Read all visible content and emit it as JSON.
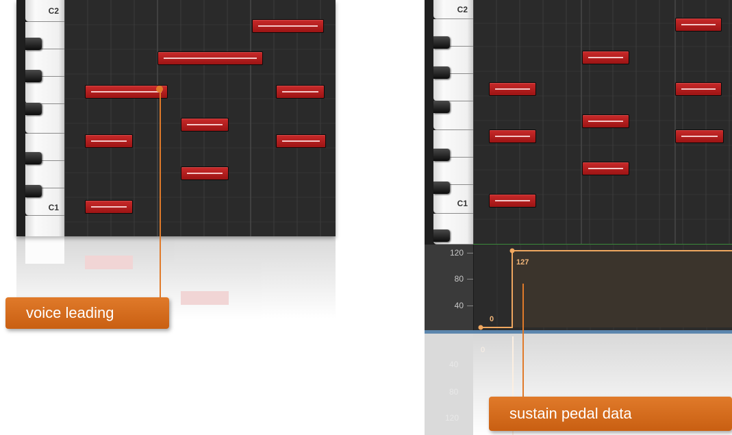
{
  "left_editor": {
    "key_labels": {
      "c2": "C2",
      "c1": "C1"
    },
    "callout": "voice leading"
  },
  "right_editor": {
    "key_labels": {
      "c2": "C2",
      "c1": "C1"
    },
    "cc_axis": {
      "t120": "120",
      "t80": "80",
      "t40": "40"
    },
    "cc_values": {
      "start": "0",
      "peak": "127"
    },
    "reflection_labels": {
      "start": "0",
      "t40": "40",
      "t80": "80",
      "t120": "120"
    },
    "callout": "sustain pedal data"
  },
  "colors": {
    "note_fill": "#b31d1d",
    "note_line": "#f5c9c9",
    "callout": "#d96c1e",
    "cc_line": "#f0a860",
    "grid_bg": "#2a2a2a"
  }
}
